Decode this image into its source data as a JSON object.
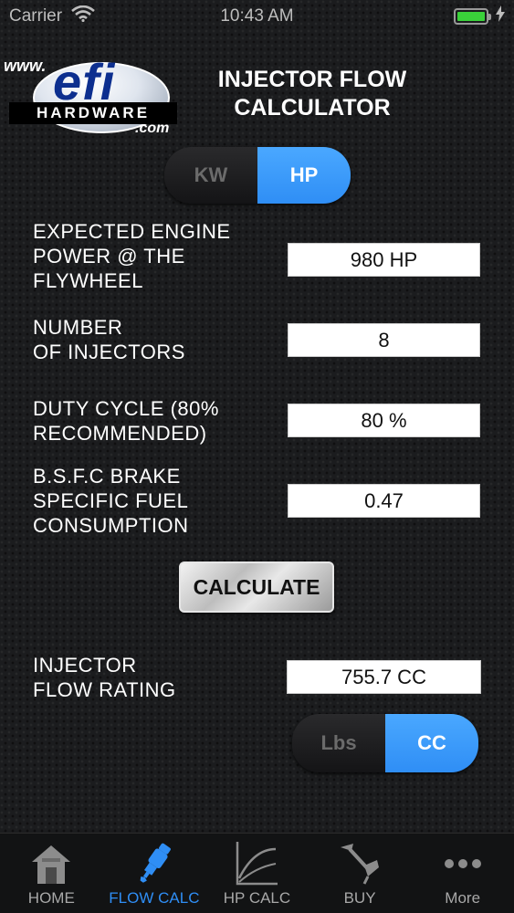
{
  "status": {
    "carrier": "Carrier",
    "time": "10:43 AM"
  },
  "logo": {
    "www": "www.",
    "efi": "efi",
    "hardware": "HARDWARE",
    "com": ".com"
  },
  "title": {
    "line1": "INJECTOR FLOW",
    "line2": "CALCULATOR"
  },
  "unit_toggle": {
    "option1": "KW",
    "option2": "HP",
    "selected": "HP"
  },
  "fields": [
    {
      "label_lines": [
        "EXPECTED ENGINE",
        "POWER @ THE",
        "FLYWHEEL"
      ],
      "value": "980 HP"
    },
    {
      "label_lines": [
        "NUMBER",
        "OF INJECTORS"
      ],
      "value": "8"
    },
    {
      "label_lines": [
        "DUTY CYCLE (80%",
        "RECOMMENDED)"
      ],
      "value": "80 %"
    },
    {
      "label_lines": [
        "B.S.F.C BRAKE",
        "SPECIFIC FUEL",
        "CONSUMPTION"
      ],
      "value": "0.47"
    }
  ],
  "calculate_label": "CALCULATE",
  "result": {
    "label_lines": [
      "INJECTOR",
      "FLOW RATING"
    ],
    "value": "755.7 CC"
  },
  "flow_toggle": {
    "option1": "Lbs",
    "option2": "CC",
    "selected": "CC"
  },
  "tabs": [
    {
      "label": "HOME",
      "icon": "home-icon"
    },
    {
      "label": "FLOW CALC",
      "icon": "injector-icon",
      "active": true
    },
    {
      "label": "HP CALC",
      "icon": "graph-icon"
    },
    {
      "label": "BUY",
      "icon": "buy-icon"
    },
    {
      "label": "More",
      "icon": "more-icon"
    }
  ],
  "colors": {
    "accent": "#2f8ef5",
    "background": "#1b1c1e",
    "battery": "#3ad13a"
  }
}
